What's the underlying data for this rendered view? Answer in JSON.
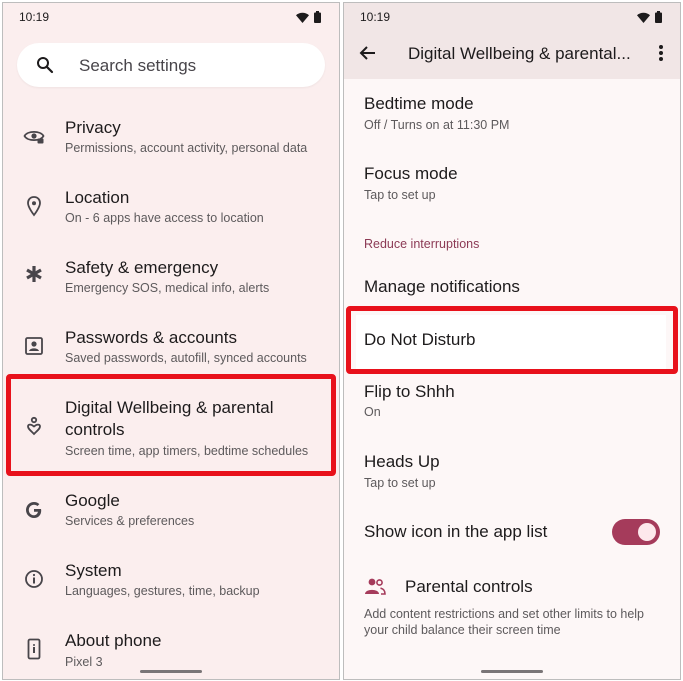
{
  "left_screen": {
    "status": {
      "time": "10:19"
    },
    "search": {
      "placeholder": "Search settings"
    },
    "items": [
      {
        "title": "Privacy",
        "subtitle": "Permissions, account activity, personal data",
        "icon": "privacy-eye-icon"
      },
      {
        "title": "Location",
        "subtitle": "On - 6 apps have access to location",
        "icon": "location-pin-icon"
      },
      {
        "title": "Safety & emergency",
        "subtitle": "Emergency SOS, medical info, alerts",
        "icon": "asterisk-icon"
      },
      {
        "title": "Passwords & accounts",
        "subtitle": "Saved passwords, autofill, synced accounts",
        "icon": "account-box-icon"
      },
      {
        "title_line1": "Digital Wellbeing & parental",
        "title_line2": "controls",
        "subtitle": "Screen time, app timers, bedtime schedules",
        "icon": "wellbeing-icon"
      },
      {
        "title": "Google",
        "subtitle": "Services & preferences",
        "icon": "google-g-icon"
      },
      {
        "title": "System",
        "subtitle": "Languages, gestures, time, backup",
        "icon": "info-circle-icon"
      },
      {
        "title": "About phone",
        "subtitle": "Pixel 3",
        "icon": "phone-icon"
      }
    ]
  },
  "right_screen": {
    "status": {
      "time": "10:19"
    },
    "appbar": {
      "title": "Digital Wellbeing & parental..."
    },
    "items": {
      "bedtime": {
        "title": "Bedtime mode",
        "subtitle": "Off / Turns on at 11:30 PM"
      },
      "focus": {
        "title": "Focus mode",
        "subtitle": "Tap to set up"
      },
      "section": "Reduce interruptions",
      "manage_notifications": {
        "title": "Manage notifications"
      },
      "dnd": {
        "title": "Do Not Disturb"
      },
      "flip": {
        "title": "Flip to Shhh",
        "subtitle": "On"
      },
      "heads_up": {
        "title": "Heads Up",
        "subtitle": "Tap to set up"
      },
      "show_icon": {
        "title": "Show icon in the app list",
        "toggle_on": true
      },
      "parental": {
        "title": "Parental controls",
        "description": "Add content restrictions and set other limits to help your child balance their screen time"
      }
    }
  },
  "colors": {
    "left_bg": "#fbeeee",
    "right_bg": "#fdf7f7",
    "appbar_bg": "#f1e6e6",
    "accent": "#a53b5b",
    "section_label": "#8c3a55",
    "highlight": "#e8111b"
  }
}
